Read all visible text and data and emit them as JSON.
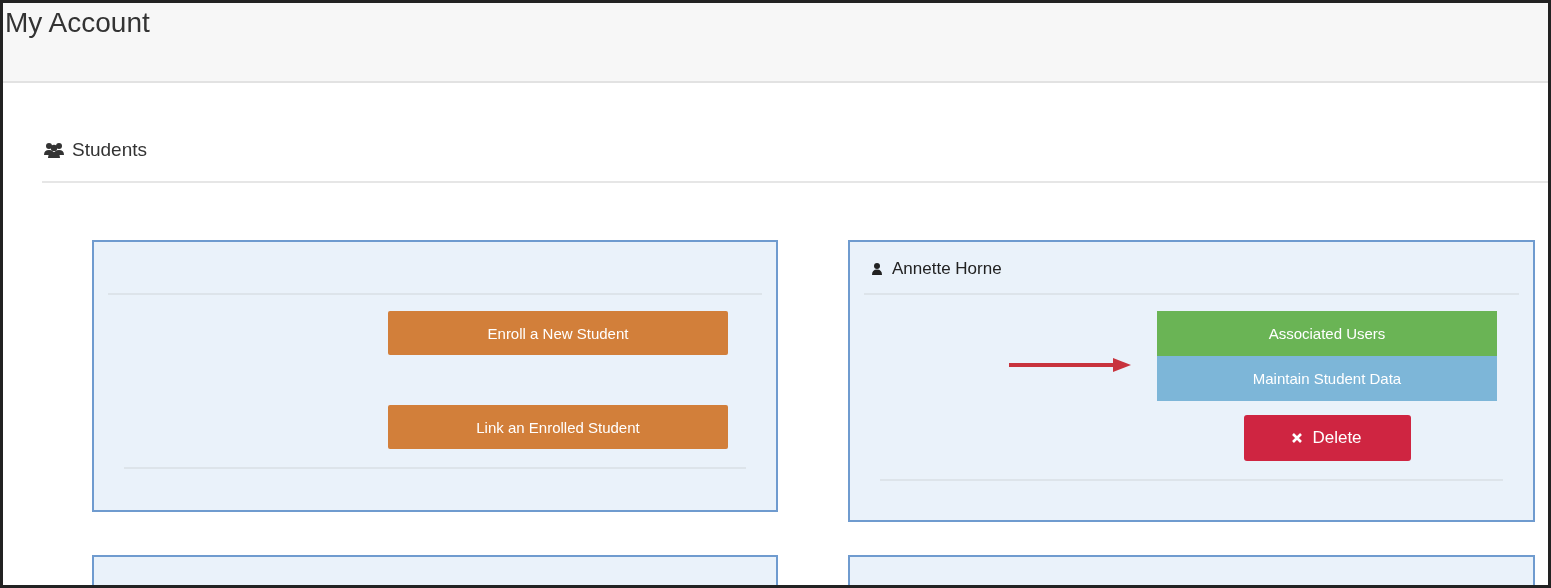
{
  "page": {
    "title": "My Account"
  },
  "section": {
    "title": "Students"
  },
  "cards": [
    {
      "buttons": [
        {
          "label": "Enroll a New Student",
          "kind": "action",
          "color": "#d27f3a"
        },
        {
          "label": "Link an Enrolled Student",
          "kind": "action",
          "color": "#d27f3a"
        }
      ]
    },
    {
      "header": "Annette Horne",
      "buttons": [
        {
          "label": "Associated Users",
          "kind": "action",
          "color": "#6ab455"
        },
        {
          "label": "Maintain Student Data",
          "kind": "action",
          "color": "#7db6d8"
        },
        {
          "label": "Delete",
          "kind": "danger",
          "color": "#cf2541"
        }
      ]
    }
  ]
}
